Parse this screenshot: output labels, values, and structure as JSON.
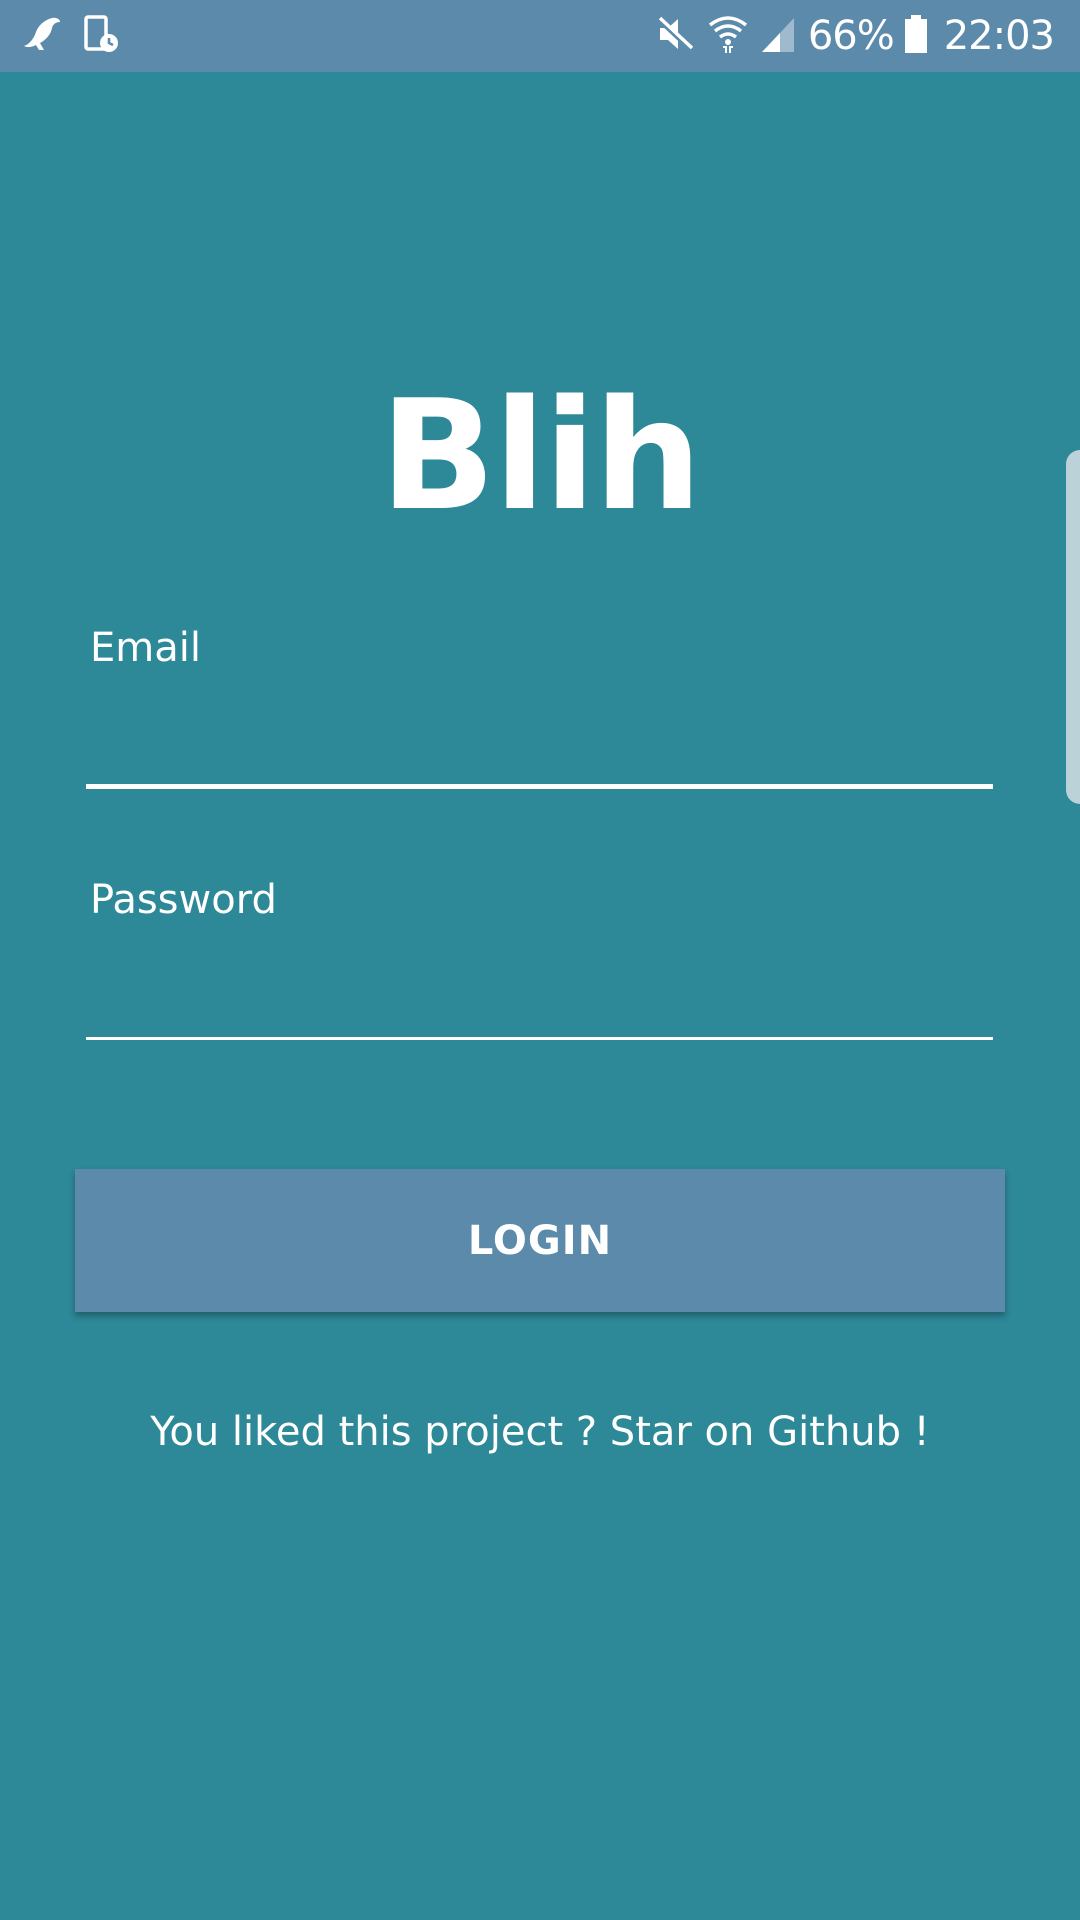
{
  "status_bar": {
    "battery_percent": "66%",
    "time": "22:03",
    "icons": [
      "bird-notification-icon",
      "tablet-clock-icon",
      "mute-icon",
      "wifi-icon",
      "signal-icon",
      "battery-icon"
    ]
  },
  "app": {
    "title": "Blih"
  },
  "form": {
    "email_label": "Email",
    "email_value": "",
    "password_label": "Password",
    "password_value": "",
    "login_label": "LOGIN"
  },
  "footer": {
    "github_text": "You liked this project ? Star on Github !"
  },
  "colors": {
    "background": "#2d8898",
    "status_bar": "#5c8aab",
    "button": "#5c8aab",
    "text": "#ffffff"
  }
}
